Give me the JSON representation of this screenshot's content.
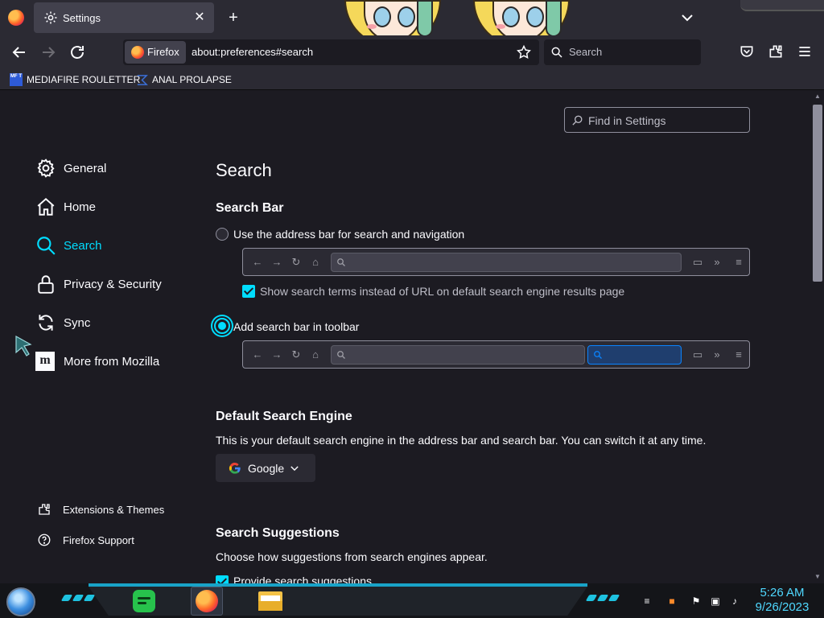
{
  "tabs": [
    {
      "title": "Settings",
      "close_icon": "close-icon"
    }
  ],
  "urlbar": {
    "identity_label": "Firefox",
    "url": "about:preferences#search"
  },
  "searchbar": {
    "placeholder": "Search"
  },
  "bookmarks": [
    {
      "label": "MEDIAFIRE ROULETTER",
      "icon_text": "MF T"
    },
    {
      "label": "ANAL PROLAPSE"
    }
  ],
  "sidebar": {
    "categories": [
      {
        "label": "General",
        "icon": "gear-icon"
      },
      {
        "label": "Home",
        "icon": "home-icon"
      },
      {
        "label": "Search",
        "icon": "search-icon",
        "selected": true
      },
      {
        "label": "Privacy & Security",
        "icon": "lock-icon"
      },
      {
        "label": "Sync",
        "icon": "sync-icon"
      },
      {
        "label": "More from Mozilla",
        "icon": "mozilla-icon",
        "icon_text": "m"
      }
    ],
    "footer": [
      {
        "label": "Extensions & Themes",
        "icon": "puzzle-icon"
      },
      {
        "label": "Firefox Support",
        "icon": "help-icon"
      }
    ]
  },
  "find": {
    "placeholder": "Find in Settings"
  },
  "main": {
    "title": "Search",
    "search_bar": {
      "heading": "Search Bar",
      "option_address": "Use the address bar for search and navigation",
      "option_toolbar": "Add search bar in toolbar",
      "selected_option": "toolbar",
      "show_terms_label": "Show search terms instead of URL on default search engine results page",
      "show_terms_checked": true
    },
    "default_engine": {
      "heading": "Default Search Engine",
      "description": "This is your default search engine in the address bar and search bar. You can switch it at any time.",
      "selected": "Google"
    },
    "suggestions": {
      "heading": "Search Suggestions",
      "description": "Choose how suggestions from search engines appear.",
      "provide_label": "Provide search suggestions",
      "provide_checked": true
    }
  },
  "taskbar": {
    "time": "5:26 AM",
    "date": "9/26/2023"
  },
  "colors": {
    "accent": "#00ddff",
    "background": "#1c1b22",
    "chrome": "#2b2a33",
    "clock": "#4fd8ff"
  }
}
